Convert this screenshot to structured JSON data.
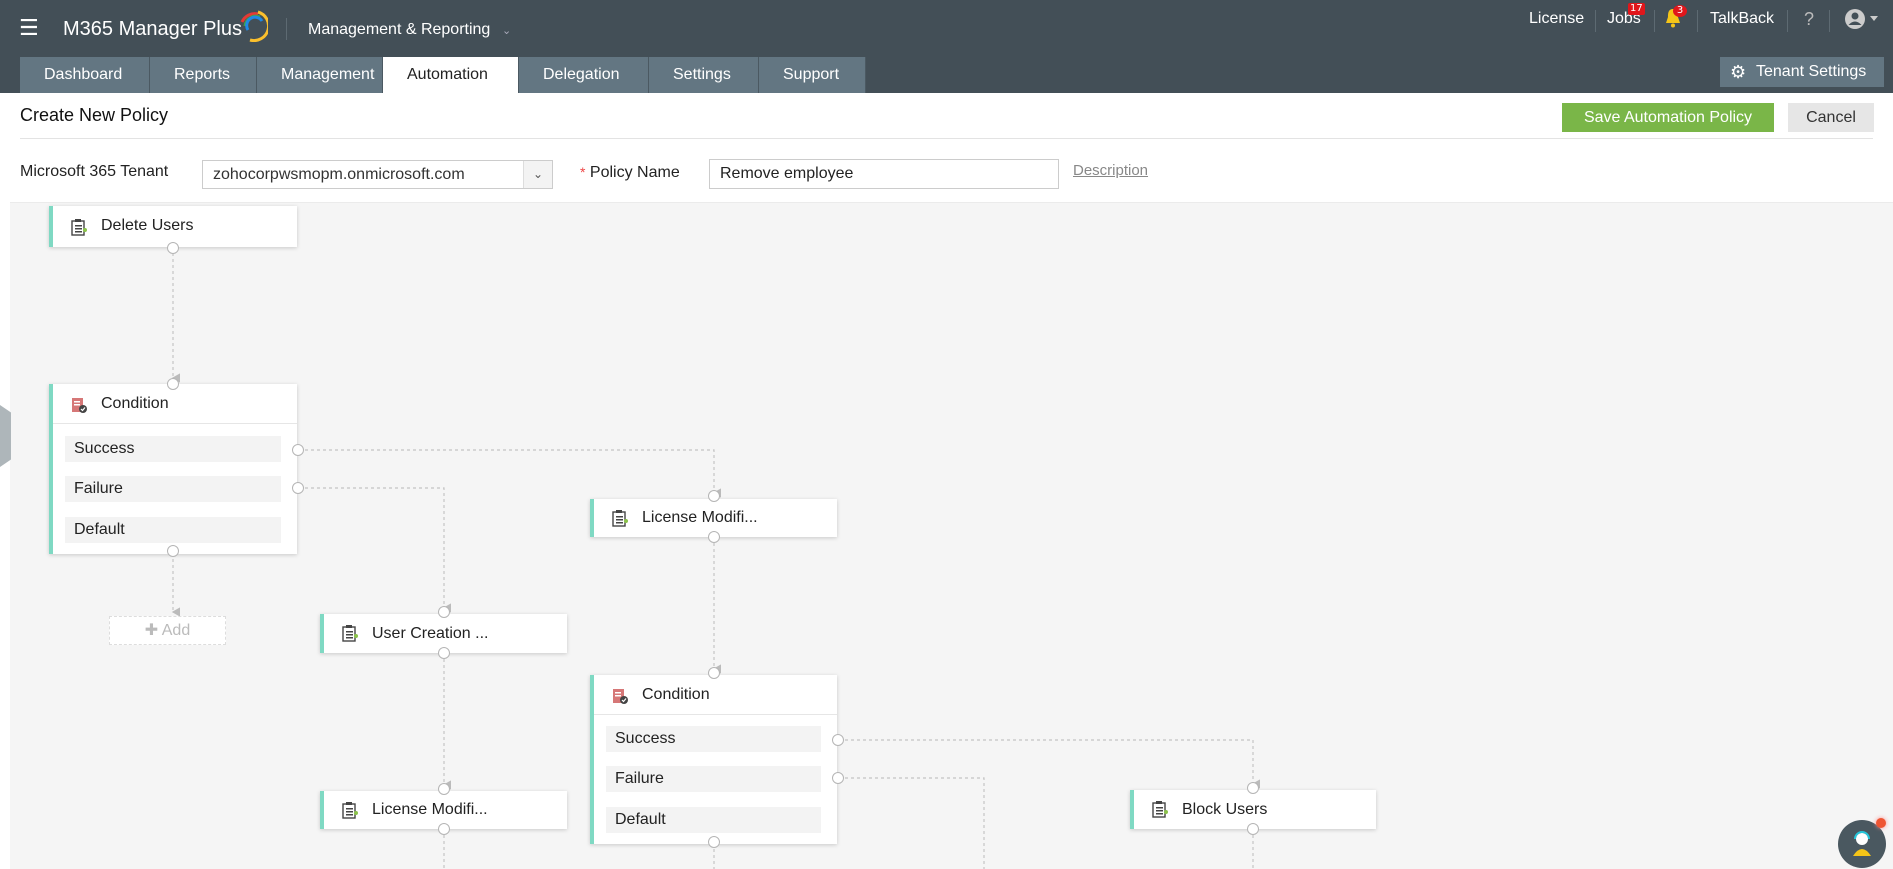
{
  "header": {
    "app_name": "M365 Manager Plus",
    "module": "Management & Reporting",
    "links": {
      "license": "License",
      "jobs": "Jobs",
      "jobs_badge": "17",
      "notif_badge": "3",
      "talkback": "TalkBack",
      "help": "?"
    },
    "tabs": [
      {
        "label": "Dashboard"
      },
      {
        "label": "Reports"
      },
      {
        "label": "Management"
      },
      {
        "label": "Automation",
        "active": true
      },
      {
        "label": "Delegation"
      },
      {
        "label": "Settings"
      },
      {
        "label": "Support"
      }
    ],
    "tenant_settings": "Tenant Settings"
  },
  "page": {
    "title": "Create New Policy",
    "save_label": "Save Automation Policy",
    "cancel_label": "Cancel",
    "tenant_label": "Microsoft 365 Tenant",
    "tenant_value": "zohocorpwsmopm.onmicrosoft.com",
    "required_mark": "*",
    "policy_name_label": "Policy Name",
    "policy_name_value": "Remove employee",
    "description_link": "Description"
  },
  "workflow": {
    "nodes": [
      {
        "id": "delete-users",
        "label": "Delete Users",
        "type": "action"
      },
      {
        "id": "condition-1",
        "label": "Condition",
        "type": "condition",
        "branches": [
          "Success",
          "Failure",
          "Default"
        ]
      },
      {
        "id": "license-mod-1",
        "label": "License Modifi...",
        "type": "action"
      },
      {
        "id": "user-creation",
        "label": "User Creation ...",
        "type": "action"
      },
      {
        "id": "condition-2",
        "label": "Condition",
        "type": "condition",
        "branches": [
          "Success",
          "Failure",
          "Default"
        ]
      },
      {
        "id": "license-mod-2",
        "label": "License Modifi...",
        "type": "action"
      },
      {
        "id": "block-users",
        "label": "Block Users",
        "type": "action"
      }
    ],
    "add_label": "Add",
    "add_icon": "plus-icon"
  },
  "colors": {
    "accent_green": "#7ab648",
    "header_bg": "#434f57",
    "tab_bg": "#637682",
    "node_accent": "#7fd9c3",
    "badge": "#e0161b"
  }
}
